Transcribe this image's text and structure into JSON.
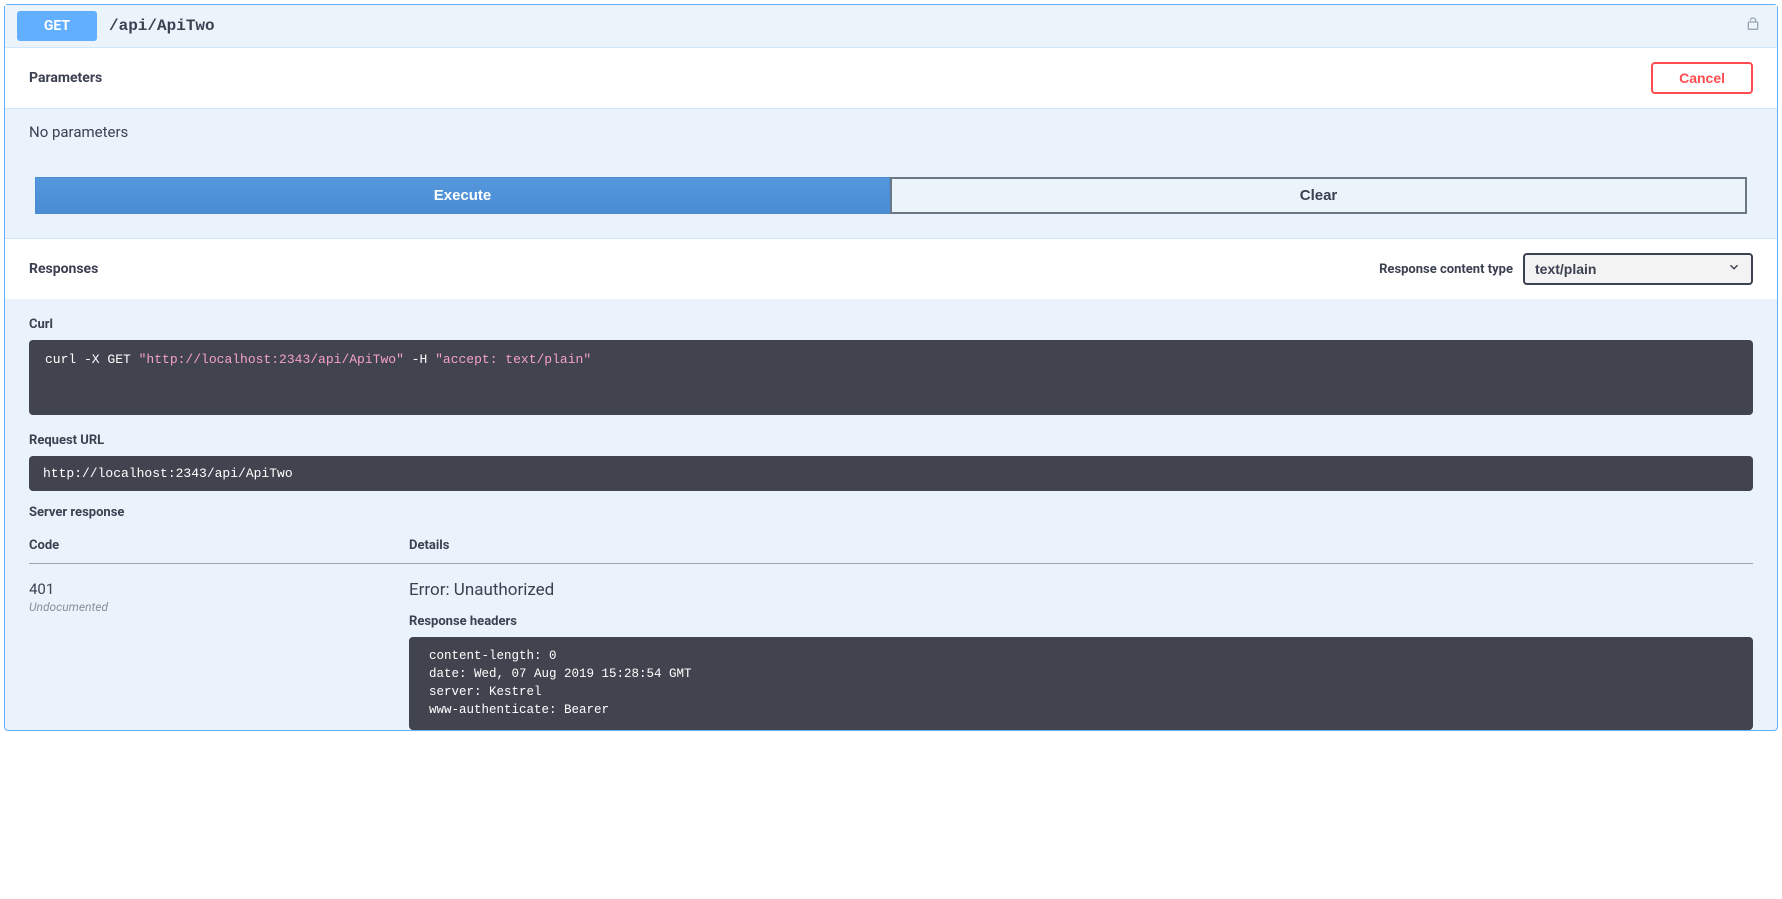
{
  "summary": {
    "method": "GET",
    "path": "/api/ApiTwo"
  },
  "parameters": {
    "title": "Parameters",
    "cancel_label": "Cancel",
    "none_text": "No parameters"
  },
  "buttons": {
    "execute": "Execute",
    "clear": "Clear"
  },
  "responses": {
    "title": "Responses",
    "content_type_label": "Response content type",
    "content_type_value": "text/plain"
  },
  "curl": {
    "title": "Curl",
    "full": "curl -X GET \"http://localhost:2343/api/ApiTwo\" -H \"accept: text/plain\"",
    "prefix": "curl -X GET ",
    "url_quoted": "\"http://localhost:2343/api/ApiTwo\"",
    "mid": " -H ",
    "accept_quoted": "\"accept: text/plain\""
  },
  "request_url": {
    "title": "Request URL",
    "value": "http://localhost:2343/api/ApiTwo"
  },
  "server_response": {
    "title": "Server response",
    "code_header": "Code",
    "details_header": "Details",
    "code": "401",
    "undocumented": "Undocumented",
    "error": "Error: Unauthorized",
    "headers_label": "Response headers",
    "headers_text": "content-length: 0\ndate: Wed, 07 Aug 2019 15:28:54 GMT\nserver: Kestrel\nwww-authenticate: Bearer"
  }
}
